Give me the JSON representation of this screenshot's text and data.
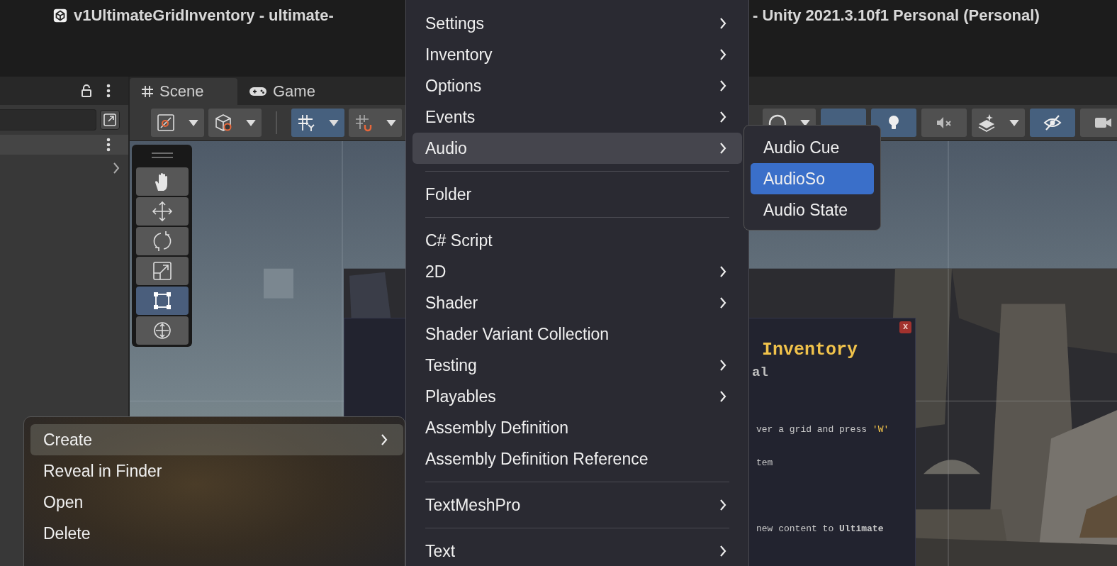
{
  "window": {
    "title_start": "v1UltimateGridInventory - ultimate-",
    "title_end": "- Unity 2021.3.10f1 Personal (Personal)"
  },
  "tabs": [
    {
      "label": "Scene",
      "kind": "scene",
      "selected": true
    },
    {
      "label": "Game",
      "kind": "game",
      "selected": false
    }
  ],
  "toolbar": {
    "left": [
      {
        "kind": "draw-mode",
        "selected": false,
        "dropdown": true
      },
      {
        "kind": "shading",
        "selected": false,
        "dropdown": true
      },
      {
        "kind": "grid-snap",
        "selected": true,
        "dropdown": true
      },
      {
        "kind": "increment-snap",
        "selected": false,
        "dropdown": true
      }
    ],
    "right": [
      {
        "kind": "gizmo",
        "selected": false,
        "dropdown": true
      },
      {
        "kind": "mode",
        "selected": true
      },
      {
        "kind": "light",
        "selected": true
      },
      {
        "kind": "audio",
        "selected": false
      },
      {
        "kind": "effects",
        "selected": false,
        "dropdown": true
      },
      {
        "kind": "visibility",
        "selected": true
      },
      {
        "kind": "camera",
        "selected": false
      }
    ]
  },
  "tools": [
    {
      "kind": "hand",
      "selected": false
    },
    {
      "kind": "move",
      "selected": false
    },
    {
      "kind": "rotate",
      "selected": false
    },
    {
      "kind": "scale",
      "selected": false
    },
    {
      "kind": "rect",
      "selected": true
    },
    {
      "kind": "transform",
      "selected": false
    }
  ],
  "inventory_panel": {
    "close": "x",
    "lines": [
      {
        "kind": "title",
        "segments": [
          {
            "text": "Inventory"
          }
        ]
      },
      {
        "kind": "subtitle",
        "segments": [
          {
            "text": "al"
          }
        ]
      },
      {
        "kind": "text",
        "segments": [
          {
            "text": "ver a grid and press ",
            "accent": false
          },
          {
            "text": "'W'",
            "accent": true
          }
        ]
      },
      {
        "kind": "text",
        "segments": [
          {
            "text": "tem"
          }
        ]
      },
      {
        "kind": "text",
        "segments": [
          {
            "text": "new content to **Ultimate**"
          }
        ]
      }
    ]
  },
  "context_menu": {
    "items": [
      {
        "label": "Create",
        "submenu": true,
        "selected": true
      },
      {
        "label": "Reveal in Finder",
        "submenu": false,
        "selected": false
      },
      {
        "label": "Open",
        "submenu": false,
        "selected": false
      },
      {
        "label": "Delete",
        "submenu": false,
        "selected": false
      }
    ]
  },
  "create_menu": {
    "items": [
      {
        "kind": "item",
        "label": "Settings",
        "submenu": true,
        "selected": false
      },
      {
        "kind": "item",
        "label": "Inventory",
        "submenu": true,
        "selected": false
      },
      {
        "kind": "item",
        "label": "Options",
        "submenu": true,
        "selected": false
      },
      {
        "kind": "item",
        "label": "Events",
        "submenu": true,
        "selected": false
      },
      {
        "kind": "item",
        "label": "Audio",
        "submenu": true,
        "selected": true
      },
      {
        "kind": "separator"
      },
      {
        "kind": "item",
        "label": "Folder",
        "submenu": false,
        "selected": false
      },
      {
        "kind": "separator"
      },
      {
        "kind": "item",
        "label": "C# Script",
        "submenu": false,
        "selected": false
      },
      {
        "kind": "item",
        "label": "2D",
        "submenu": true,
        "selected": false
      },
      {
        "kind": "item",
        "label": "Shader",
        "submenu": true,
        "selected": false
      },
      {
        "kind": "item",
        "label": "Shader Variant Collection",
        "submenu": false,
        "selected": false
      },
      {
        "kind": "item",
        "label": "Testing",
        "submenu": true,
        "selected": false
      },
      {
        "kind": "item",
        "label": "Playables",
        "submenu": true,
        "selected": false
      },
      {
        "kind": "item",
        "label": "Assembly Definition",
        "submenu": false,
        "selected": false
      },
      {
        "kind": "item",
        "label": "Assembly Definition Reference",
        "submenu": false,
        "selected": false
      },
      {
        "kind": "separator"
      },
      {
        "kind": "item",
        "label": "TextMeshPro",
        "submenu": true,
        "selected": false
      },
      {
        "kind": "separator"
      },
      {
        "kind": "item",
        "label": "Text",
        "submenu": true,
        "selected": false
      }
    ]
  },
  "audio_menu": {
    "items": [
      {
        "label": "Audio Cue",
        "selected": false
      },
      {
        "label": "AudioSo",
        "selected": true
      },
      {
        "label": "Audio State",
        "selected": false
      }
    ]
  }
}
